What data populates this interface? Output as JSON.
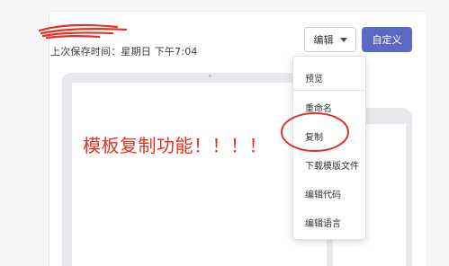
{
  "status": {
    "last_saved": "上次保存时间：星期日 下午7:04"
  },
  "toolbar": {
    "edit_label": "编辑",
    "customize_label": "自定义"
  },
  "menu": {
    "items": [
      {
        "label": "预览"
      },
      {
        "label": "重命名"
      },
      {
        "label": "复制"
      },
      {
        "label": "下载模版文件"
      },
      {
        "label": "编辑代码"
      },
      {
        "label": "编辑语言"
      }
    ]
  },
  "annotation": {
    "text": "模板复制功能！！！！"
  },
  "colors": {
    "accent": "#5c6ac4",
    "annotation_red": "#e53226",
    "background": "#f4f6f8",
    "frame_grey": "#e7e9ec"
  }
}
